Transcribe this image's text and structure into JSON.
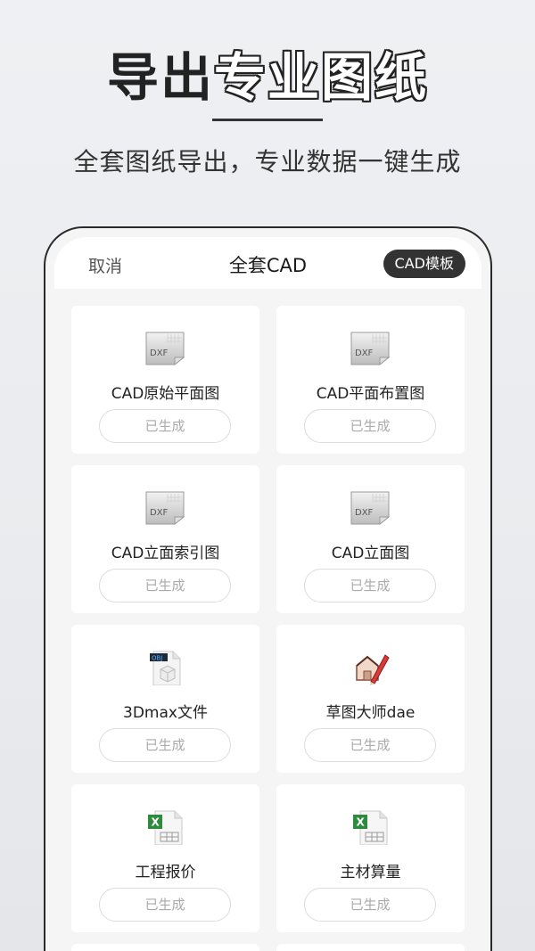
{
  "hero": {
    "title_dark": "导出",
    "title_outline": "专业图纸",
    "subtitle": "全套图纸导出，专业数据一键生成"
  },
  "nav": {
    "cancel": "取消",
    "title": "全套CAD",
    "template_button": "CAD模板"
  },
  "items": [
    {
      "label": "CAD原始平面图",
      "status": "已生成",
      "icon": "dxf-file-icon"
    },
    {
      "label": "CAD平面布置图",
      "status": "已生成",
      "icon": "dxf-file-icon"
    },
    {
      "label": "CAD立面索引图",
      "status": "已生成",
      "icon": "dxf-file-icon"
    },
    {
      "label": "CAD立面图",
      "status": "已生成",
      "icon": "dxf-file-icon"
    },
    {
      "label": "3Dmax文件",
      "status": "已生成",
      "icon": "obj-file-icon"
    },
    {
      "label": "草图大师dae",
      "status": "已生成",
      "icon": "sketchup-icon"
    },
    {
      "label": "工程报价",
      "status": "已生成",
      "icon": "excel-file-icon"
    },
    {
      "label": "主材算量",
      "status": "已生成",
      "icon": "excel-file-icon"
    }
  ],
  "icon_text": {
    "dxf": "DXF",
    "obj": "OBJ",
    "excel": "X"
  },
  "colors": {
    "dark": "#222222",
    "button_bg": "#333333",
    "status_text": "#aaaaaa",
    "excel_green": "#2e8b3e"
  }
}
